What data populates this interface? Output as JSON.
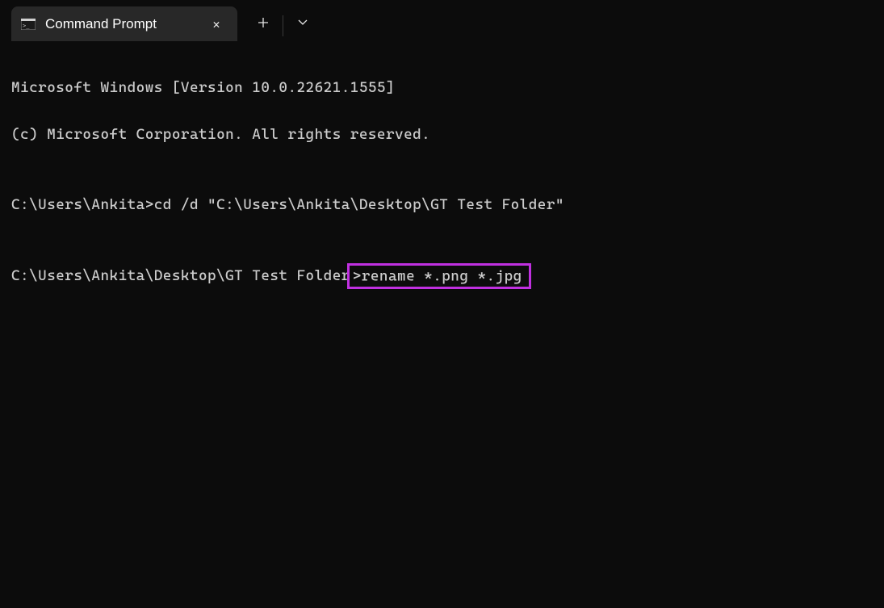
{
  "tab": {
    "title": "Command Prompt"
  },
  "terminal": {
    "line1": "Microsoft Windows [Version 10.0.22621.1555]",
    "line2": "(c) Microsoft Corporation. All rights reserved.",
    "blank1": "",
    "prompt1_path": "C:\\Users\\Ankita>",
    "prompt1_cmd": "cd /d \"C:\\Users\\Ankita\\Desktop\\GT Test Folder\"",
    "blank2": "",
    "prompt2_path": "C:\\Users\\Ankita\\Desktop\\GT Test Folder",
    "prompt2_char": ">",
    "prompt2_cmd": "rename *.png *.jpg"
  }
}
